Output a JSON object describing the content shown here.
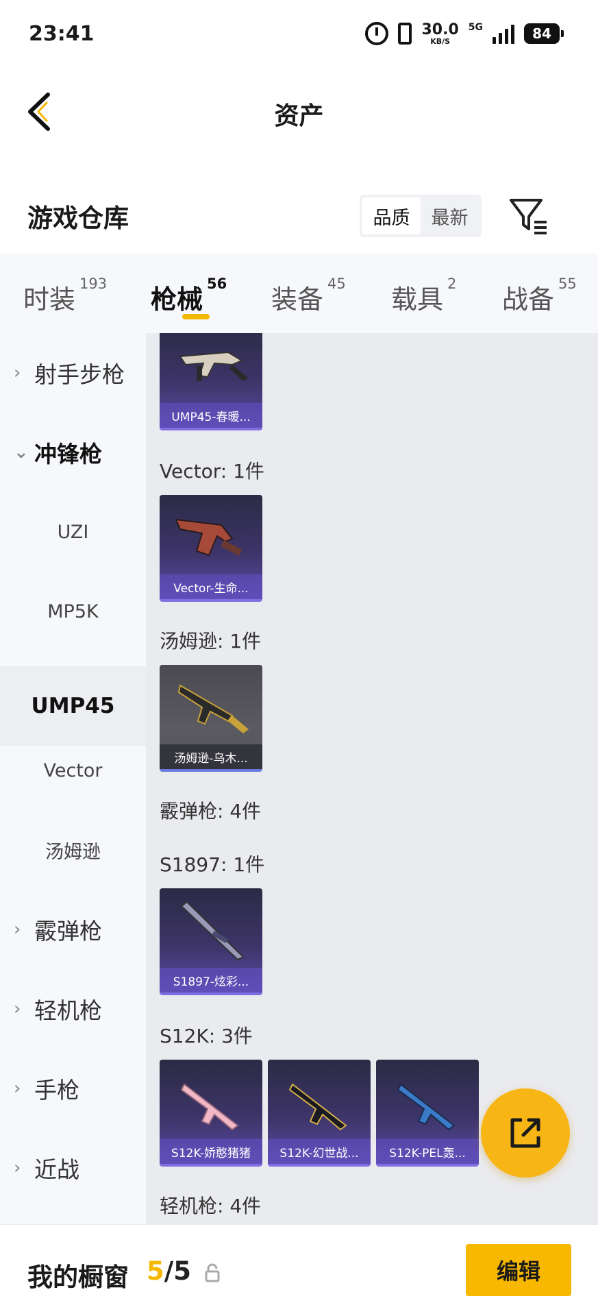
{
  "status_bar": {
    "time": "23:41",
    "net_speed": "30.0",
    "net_unit": "KB/S",
    "network": "5G",
    "battery": "84"
  },
  "header": {
    "title": "资产",
    "back_icon": "chevron-left-icon"
  },
  "warehouse": {
    "title": "游戏仓库",
    "sort_options": [
      "品质",
      "最新"
    ],
    "sort_selected": "品质",
    "filter_icon": "filter-icon"
  },
  "tabs": [
    {
      "label": "时装",
      "count": "193"
    },
    {
      "label": "枪械",
      "count": "56",
      "active": true
    },
    {
      "label": "装备",
      "count": "45"
    },
    {
      "label": "载具",
      "count": "2"
    },
    {
      "label": "战备",
      "count": "55"
    }
  ],
  "sidebar": {
    "items": [
      {
        "label": "射手步枪",
        "type": "category",
        "state": "collapsed"
      },
      {
        "label": "冲锋枪",
        "type": "category",
        "state": "expanded"
      },
      {
        "label": "UZI",
        "type": "sub"
      },
      {
        "label": "MP5K",
        "type": "sub"
      },
      {
        "label": "UMP45",
        "type": "sub",
        "selected": true
      },
      {
        "label": "Vector",
        "type": "sub"
      },
      {
        "label": "汤姆逊",
        "type": "sub"
      },
      {
        "label": "霰弹枪",
        "type": "category",
        "state": "collapsed"
      },
      {
        "label": "轻机枪",
        "type": "category",
        "state": "collapsed"
      },
      {
        "label": "手枪",
        "type": "category",
        "state": "collapsed"
      },
      {
        "label": "近战",
        "type": "category",
        "state": "collapsed"
      }
    ]
  },
  "content": {
    "groups": [
      {
        "label": "",
        "items": [
          {
            "name": "UMP45-春暖...",
            "style": "purple"
          }
        ]
      },
      {
        "label": "Vector: 1件",
        "items": [
          {
            "name": "Vector-生命...",
            "style": "purple"
          }
        ]
      },
      {
        "label": "汤姆逊: 1件",
        "items": [
          {
            "name": "汤姆逊-乌木...",
            "style": "grey"
          }
        ]
      },
      {
        "label": "霰弹枪: 4件",
        "items": []
      },
      {
        "label": "S1897: 1件",
        "items": [
          {
            "name": "S1897-炫彩...",
            "style": "purple"
          }
        ]
      },
      {
        "label": "S12K: 3件",
        "items": [
          {
            "name": "S12K-娇憨猪猪",
            "style": "purple"
          },
          {
            "name": "S12K-幻世战...",
            "style": "purple"
          },
          {
            "name": "S12K-PEL轰...",
            "style": "purple"
          }
        ]
      },
      {
        "label": "轻机枪: 4件",
        "items": []
      }
    ]
  },
  "fab": {
    "icon": "share-icon"
  },
  "bottom_bar": {
    "label": "我的橱窗",
    "count_current": "5",
    "count_total": "/5",
    "lock_icon": "lock-icon",
    "edit_label": "编辑"
  },
  "colors": {
    "accent": "#f8b800",
    "card_purple": "#5b4ca6",
    "panel_bg": "#eaebef"
  }
}
